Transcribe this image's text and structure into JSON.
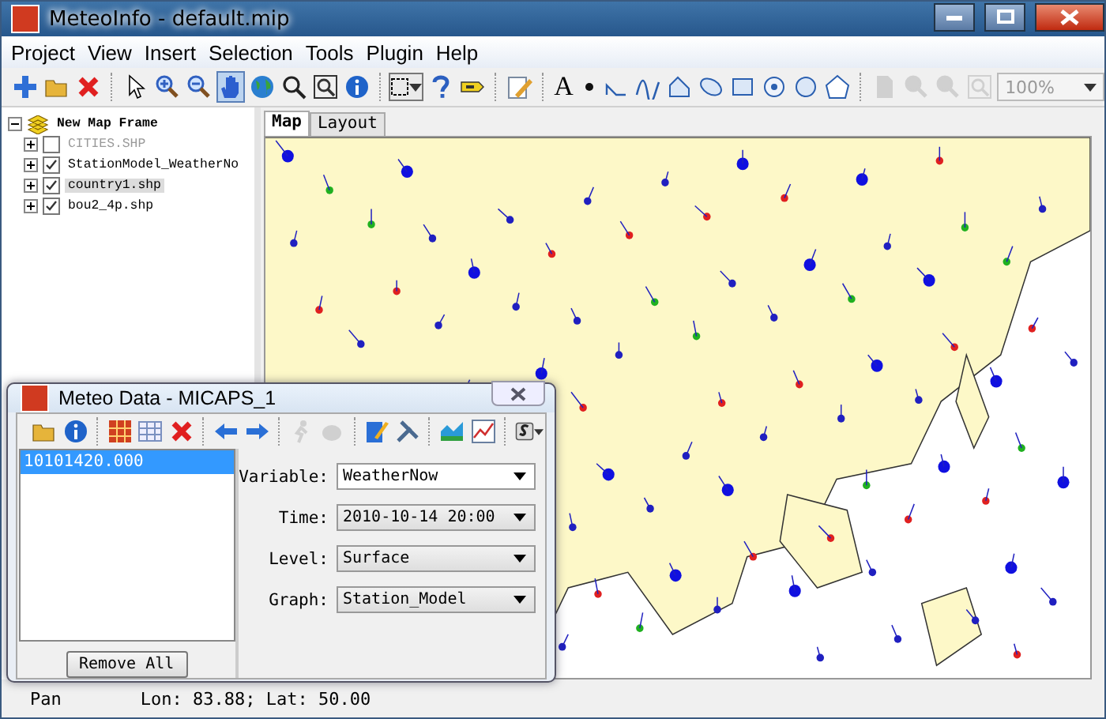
{
  "window": {
    "title": "MeteoInfo - default.mip"
  },
  "menu": [
    "Project",
    "View",
    "Insert",
    "Selection",
    "Tools",
    "Plugin",
    "Help"
  ],
  "toolbar": [
    {
      "kind": "plus",
      "selected": false,
      "disabled": false
    },
    {
      "kind": "folder",
      "selected": false,
      "disabled": false
    },
    {
      "kind": "cross",
      "selected": false,
      "disabled": false
    },
    {
      "kind": "sep"
    },
    {
      "kind": "pointer",
      "selected": false,
      "disabled": false
    },
    {
      "kind": "zoomin",
      "selected": false,
      "disabled": false
    },
    {
      "kind": "zoomout",
      "selected": false,
      "disabled": false
    },
    {
      "kind": "hand",
      "selected": true,
      "disabled": false
    },
    {
      "kind": "globe",
      "selected": false,
      "disabled": false
    },
    {
      "kind": "magnifier",
      "selected": false,
      "disabled": false
    },
    {
      "kind": "extent",
      "selected": false,
      "disabled": false
    },
    {
      "kind": "info",
      "selected": false,
      "disabled": false
    },
    {
      "kind": "sep"
    },
    {
      "kind": "selectbox",
      "selected": false,
      "disabled": false
    },
    {
      "kind": "help",
      "selected": false,
      "disabled": false
    },
    {
      "kind": "tag",
      "selected": false,
      "disabled": false
    },
    {
      "kind": "sep"
    },
    {
      "kind": "edit",
      "selected": false,
      "disabled": false
    },
    {
      "kind": "sep"
    },
    {
      "kind": "text",
      "glyph": "A",
      "selected": false,
      "disabled": false
    },
    {
      "kind": "dot",
      "selected": false,
      "disabled": false
    },
    {
      "kind": "polyline",
      "selected": false,
      "disabled": false
    },
    {
      "kind": "curve",
      "selected": false,
      "disabled": false
    },
    {
      "kind": "polygon",
      "selected": false,
      "disabled": false
    },
    {
      "kind": "ellipseshape",
      "selected": false,
      "disabled": false
    },
    {
      "kind": "rect",
      "selected": false,
      "disabled": false
    },
    {
      "kind": "circledot",
      "selected": false,
      "disabled": false
    },
    {
      "kind": "circle",
      "selected": false,
      "disabled": false
    },
    {
      "kind": "pentagon",
      "selected": false,
      "disabled": false
    },
    {
      "kind": "sep"
    },
    {
      "kind": "page",
      "selected": false,
      "disabled": true
    },
    {
      "kind": "zoomin",
      "selected": false,
      "disabled": true
    },
    {
      "kind": "zoomout",
      "selected": false,
      "disabled": true
    },
    {
      "kind": "extent",
      "selected": false,
      "disabled": true
    },
    {
      "kind": "combo",
      "value": "100%",
      "disabled": true
    }
  ],
  "layers": {
    "label": "New Map Frame",
    "expanded": true,
    "children": [
      {
        "label": "CITIES.SHP",
        "checked": false,
        "selected": false,
        "expanded": false,
        "disabled": true
      },
      {
        "label": "StationModel_WeatherNo",
        "checked": true,
        "selected": false,
        "expanded": false,
        "disabled": false
      },
      {
        "label": "country1.shp",
        "checked": true,
        "selected": true,
        "expanded": false,
        "disabled": false
      },
      {
        "label": "bou2_4p.shp",
        "checked": true,
        "selected": false,
        "expanded": false,
        "disabled": false
      }
    ]
  },
  "tabs": [
    {
      "label": "Map",
      "selected": true
    },
    {
      "label": "Layout",
      "selected": false
    }
  ],
  "status_bar": {
    "mode": "Pan",
    "coords": "Lon: 83.88; Lat: 50.00"
  },
  "dialog": {
    "title": "Meteo Data - MICAPS_1",
    "toolbar": [
      {
        "kind": "folder",
        "disabled": false
      },
      {
        "kind": "info",
        "disabled": false
      },
      {
        "kind": "sep"
      },
      {
        "kind": "grid",
        "disabled": false
      },
      {
        "kind": "table",
        "disabled": false
      },
      {
        "kind": "cross",
        "disabled": false
      },
      {
        "kind": "sep"
      },
      {
        "kind": "left",
        "disabled": false
      },
      {
        "kind": "right",
        "disabled": false
      },
      {
        "kind": "sep"
      },
      {
        "kind": "runner",
        "disabled": true
      },
      {
        "kind": "blob",
        "disabled": true
      },
      {
        "kind": "sep"
      },
      {
        "kind": "draw",
        "disabled": false
      },
      {
        "kind": "tools",
        "disabled": false
      },
      {
        "kind": "sep"
      },
      {
        "kind": "chart",
        "disabled": false
      },
      {
        "kind": "chart2",
        "disabled": false
      },
      {
        "kind": "sep"
      },
      {
        "kind": "save",
        "disabled": false
      }
    ],
    "files": [
      {
        "label": "10101420.000",
        "selected": true
      }
    ],
    "remove_button": "Remove All",
    "fields": [
      {
        "label": "Variable:",
        "value": "WeatherNow",
        "kind": "white"
      },
      {
        "label": "Time:",
        "value": "2010-10-14 20:00",
        "kind": "grey"
      },
      {
        "label": "Level:",
        "value": "Surface",
        "kind": "grey"
      },
      {
        "label": "Graph:",
        "value": "Station_Model",
        "kind": "grey"
      }
    ]
  }
}
